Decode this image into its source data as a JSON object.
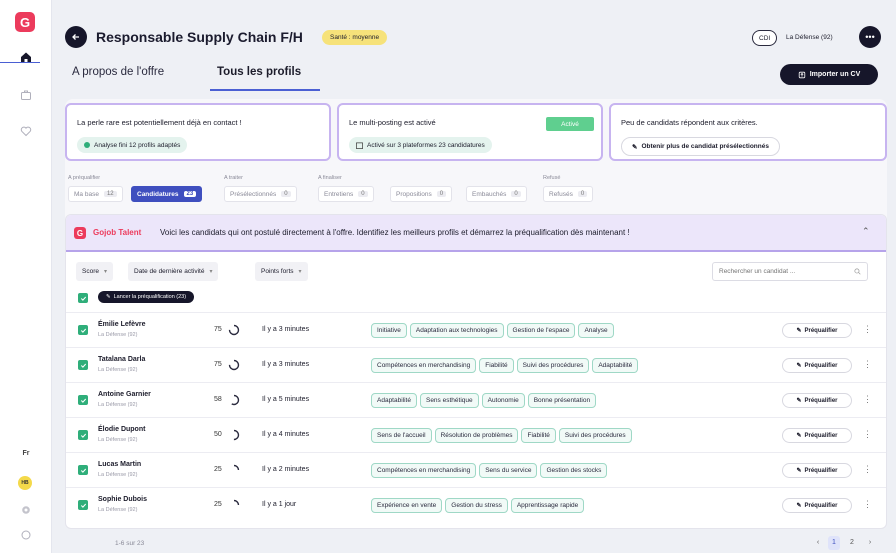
{
  "app": {
    "logo_letter": "G",
    "lang": "Fr",
    "user_initials": "HB"
  },
  "job": {
    "title": "Responsable Supply Chain F/H",
    "health": "Santé : moyenne",
    "contract": "CDI",
    "location": "La Défense (92)"
  },
  "tabs": [
    {
      "label": "A propos de l'offre"
    },
    {
      "label": "Tous les profils"
    }
  ],
  "import_cv_label": "Importer un CV",
  "cards": {
    "rare": {
      "title": "La perle rare est potentiellement déjà en contact !",
      "pill": "Analyse fini  12 profils adaptés"
    },
    "multiposting": {
      "title": "Le multi-posting est activé",
      "status": "Activé",
      "pill": "Activé sur 3 plateformes  23 candidatures"
    },
    "few": {
      "title": "Peu de candidats répondent aux critères.",
      "button": "Obtenir plus de candidat présélectionnés"
    }
  },
  "stage_groups": [
    "A préqualifier",
    "A traiter",
    "A finaliser",
    "Refusé"
  ],
  "stages": [
    {
      "label": "Ma base",
      "count": "12"
    },
    {
      "label": "Candidatures",
      "count": "23",
      "active": true
    },
    {
      "label": "Présélectionnés",
      "count": "0"
    },
    {
      "label": "Entretiens",
      "count": "0"
    },
    {
      "label": "Propositions",
      "count": "0"
    },
    {
      "label": "Embauchés",
      "count": "0"
    },
    {
      "label": "Refusés",
      "count": "0"
    }
  ],
  "talent": {
    "brand": "Gojob Talent",
    "message": "Voici les candidats qui ont postulé directement à l'offre. Identifiez les meilleurs profils et démarrez la préqualification dès maintenant !"
  },
  "filters": {
    "score": "Score",
    "date": "Date de dernière activité",
    "strengths": "Points forts",
    "search_placeholder": "Rechercher un candidat ..."
  },
  "bulk_label": "Lancer la préqualification (23)",
  "prequalify_label": "Préqualifier",
  "candidates": [
    {
      "name": "Émilie Lefèvre",
      "location": "La Défense (92)",
      "score": 75,
      "time": "Il y a 3 minutes",
      "tags": [
        "Initiative",
        "Adaptation aux technologies",
        "Gestion de l'espace",
        "Analyse"
      ]
    },
    {
      "name": "Tatalana Darla",
      "location": "La Défense (92)",
      "score": 75,
      "time": "Il y a 3 minutes",
      "tags": [
        "Compétences en merchandising",
        "Fiabilité",
        "Suivi des procédures",
        "Adaptabilité"
      ]
    },
    {
      "name": "Antoine Garnier",
      "location": "La Défense (92)",
      "score": 58,
      "time": "Il y a 5 minutes",
      "tags": [
        "Adaptabilité",
        "Sens esthétique",
        "Autonomie",
        "Bonne présentation"
      ]
    },
    {
      "name": "Élodie Dupont",
      "location": "La Défense (92)",
      "score": 50,
      "time": "Il y a 4 minutes",
      "tags": [
        "Sens de l'accueil",
        "Résolution de problèmes",
        "Fiabilité",
        "Suivi des procédures"
      ]
    },
    {
      "name": "Lucas Martin",
      "location": "La Défense (92)",
      "score": 25,
      "time": "Il y a 2 minutes",
      "tags": [
        "Compétences en merchandising",
        "Sens du service",
        "Gestion des stocks"
      ]
    },
    {
      "name": "Sophie Dubois",
      "location": "La Défense (92)",
      "score": 25,
      "time": "Il y a 1 jour",
      "tags": [
        "Expérience en vente",
        "Gestion du stress",
        "Apprentissage rapide"
      ]
    }
  ],
  "pagination": {
    "summary": "1-6 sur 23",
    "pages": [
      "1",
      "2"
    ],
    "current": "1"
  },
  "colors": {
    "accent": "#3f4fbf",
    "brand": "#ec3b5c",
    "success": "#2fae7a",
    "highlight": "#f6e27a"
  },
  "icons": [
    "gojob-logo",
    "home-icon",
    "briefcase-icon",
    "heart-icon",
    "settings-icon",
    "logout-icon",
    "arrow-left-icon",
    "more-icon",
    "upload-icon",
    "wand-icon",
    "chevron-up-icon",
    "chevron-down-icon",
    "search-icon",
    "check-icon",
    "kebab-icon"
  ]
}
